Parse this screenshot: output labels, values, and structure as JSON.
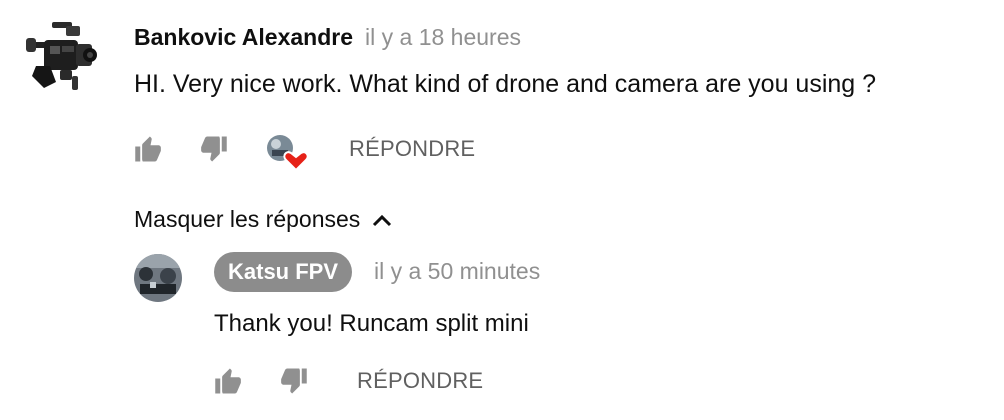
{
  "comment": {
    "author": "Bankovic Alexandre",
    "time": "il y a 18 heures",
    "text": "HI. Very nice work. What kind of drone and camera are you using ?",
    "reply_label": "RÉPONDRE",
    "icons": {
      "like": "thumbs-up-icon",
      "dislike": "thumbs-down-icon",
      "creator_heart": "heart-icon"
    },
    "heart_color": "#e62117"
  },
  "replies_toggle": {
    "label": "Masquer les réponses",
    "icon": "chevron-up-icon"
  },
  "reply": {
    "author": "Katsu FPV",
    "time": "il y a 50 minutes",
    "text": "Thank you! Runcam split mini",
    "reply_label": "RÉPONDRE",
    "badge_color": "#8c8c8c"
  },
  "colors": {
    "text_primary": "#0f0f0f",
    "text_secondary": "#909090",
    "icon_grey": "#909090"
  }
}
